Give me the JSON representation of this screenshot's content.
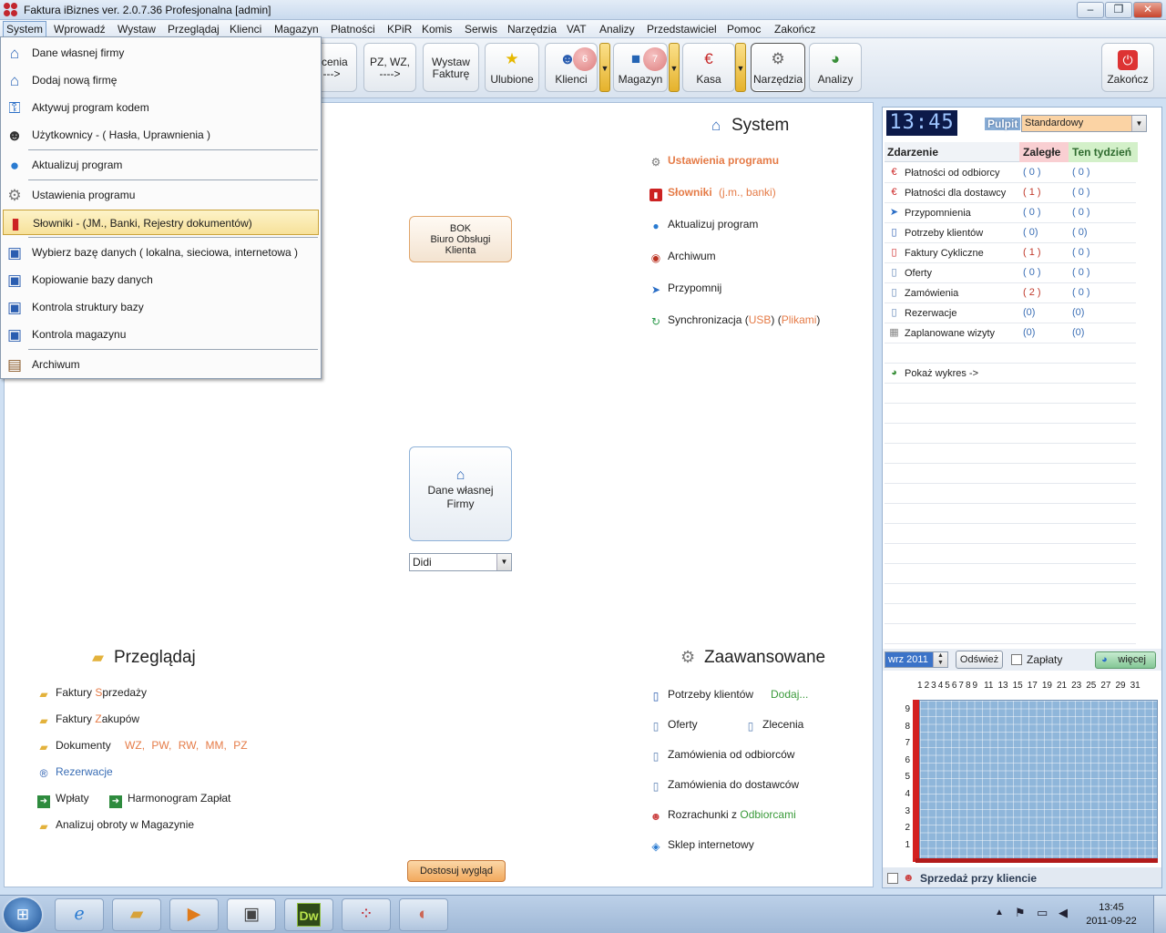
{
  "window": {
    "title": "Faktura iBiznes ver. 2.0.7.36  Profesjonalna  [admin]",
    "minimize": "‒",
    "restore": "❐",
    "close": "✕"
  },
  "menubar": [
    "System",
    "Wprowadź",
    "Wystaw",
    "Przeglądaj",
    "Klienci",
    "Magazyn",
    "Płatności",
    "KPiR",
    "Komis",
    "Serwis",
    "Narzędzia",
    "VAT",
    "Analizy",
    "Przedstawiciel",
    "Pomoc",
    "Zakończ"
  ],
  "toolbar": {
    "zlecenia": "ecenia\n--->",
    "pz": "PZ, WZ,\n---->",
    "wystaw": "Wystaw\nFakturę",
    "ulubione": "Ulubione",
    "klienci": "Klienci",
    "klienci_badge": "6",
    "magazyn": "Magazyn",
    "magazyn_badge": "7",
    "kasa": "Kasa",
    "narzedzia": "Narzędzia",
    "analizy": "Analizy",
    "zakoncz": "Zakończ",
    "ddarrow": "▼"
  },
  "dropdown": {
    "items": [
      "Dane własnej firmy",
      "Dodaj nową firmę",
      "Aktywuj program kodem",
      "Użytkownicy - ( Hasła, Uprawnienia )",
      "Aktualizuj program",
      "Ustawienia programu",
      "Słowniki - (JM., Banki, Rejestry dokumentów)",
      "Wybierz bazę danych  ( lokalna, sieciowa, internetowa )",
      "Kopiowanie bazy danych",
      "Kontrola struktury bazy",
      "Kontrola magazynu",
      "Archiwum"
    ]
  },
  "system": {
    "title": "System",
    "ustawienia": "Ustawienia programu",
    "slowniki": "Słowniki",
    "slowniki_extra": "(j.m., banki)",
    "aktualizuj": "Aktualizuj program",
    "archiwum": "Archiwum",
    "przypomnij": "Przypomnij",
    "sync": "Synchronizacja (",
    "sync_usb": "USB",
    ") (": ") (",
    "sync_plik": "Plikami",
    ")": ")"
  },
  "bok": {
    "line1": "BOK",
    "line2": "Biuro Obsługi",
    "line3": "Klienta"
  },
  "firmy": {
    "line1": "Dane własnej",
    "line2": "Firmy",
    "combo": "Didi"
  },
  "przegladaj": {
    "title": "Przeglądaj",
    "fs": "Faktury ",
    "fs_o": "S",
    "fs_r": "przedaży",
    "fz": "Faktury ",
    "fz_o": "Z",
    "fz_r": "akupów",
    "dok": "Dokumenty",
    "dtypes": [
      "WZ,",
      "PW,",
      "RW,",
      "MM,",
      "PZ"
    ],
    "rez": "Rezerwacje",
    "wplaty": "Wpłaty",
    "harm": "Harmonogram Zapłat",
    "analizuj": "Analizuj obroty w Magazynie"
  },
  "zaawansowane": {
    "title": "Zaawansowane",
    "potrzeby": "Potrzeby klientów",
    "dodaj": "Dodaj...",
    "oferty": "Oferty",
    "zlecenia": "Zlecenia",
    "zam_odb": "Zamówienia od odbiorców",
    "zam_dost": "Zamówienia do dostawców",
    "rozr": "Rozrachunki z ",
    "rozr_g": "Odbiorcami",
    "sklep": "Sklep internetowy"
  },
  "dostosuj": "Dostosuj wygląd",
  "right": {
    "clock": "13:45",
    "pulpit": "Pulpit",
    "pulpit_value": "Standardowy",
    "headers": {
      "zdarzenie": "Zdarzenie",
      "zalegle": "Zaległe",
      "tydzien": "Ten tydzień"
    },
    "rows": [
      {
        "name": "Płatności od odbiorcy",
        "z": "( 0 )",
        "t": "( 0 )"
      },
      {
        "name": "Płatności dla dostawcy",
        "z": "( 1 )",
        "t": "( 0 )"
      },
      {
        "name": "Przypomnienia",
        "z": "( 0 )",
        "t": "( 0 )"
      },
      {
        "name": "Potrzeby klientów",
        "z": "( 0)",
        "t": "( 0)"
      },
      {
        "name": "Faktury Cykliczne",
        "z": "( 1 )",
        "t": "( 0 )"
      },
      {
        "name": "Oferty",
        "z": "( 0 )",
        "t": "( 0 )"
      },
      {
        "name": "Zamówienia",
        "z": "( 2 )",
        "t": "( 0 )"
      },
      {
        "name": "Rezerwacje",
        "z": "(0)",
        "t": "(0)"
      },
      {
        "name": "Zaplanowane wizyty",
        "z": "(0)",
        "t": "(0)"
      }
    ],
    "wykres": "Pokaż wykres ->",
    "month": "wrz 2011",
    "odswiez": "Odśwież",
    "zaplaty": "Zapłaty",
    "wiecej": "więcej",
    "xlabels": [
      "1",
      "2",
      "3",
      "4",
      "5",
      "6",
      "7",
      "8",
      "9",
      "11",
      "13",
      "15",
      "17",
      "19",
      "21",
      "23",
      "25",
      "27",
      "29",
      "31"
    ],
    "ylabels": [
      "9",
      "8",
      "7",
      "6",
      "5",
      "4",
      "3",
      "2",
      "1"
    ],
    "sprzedaz": "Sprzedaż przy kliencie"
  },
  "taskbar": {
    "time": "13:45",
    "date": "2011-09-22",
    "icons": [
      "ie-icon",
      "explorer-icon",
      "media-icon",
      "network-icon",
      "dreamweaver-icon",
      "ibiznes-icon",
      "paint-icon"
    ],
    "dw": "Dw"
  },
  "colors": {
    "accent": "#e57b47",
    "link_green": "#3a9a3a",
    "link_blue": "#3a6eb5",
    "chart_bg": "#8fb6da",
    "chart_bar": "#d32020"
  }
}
